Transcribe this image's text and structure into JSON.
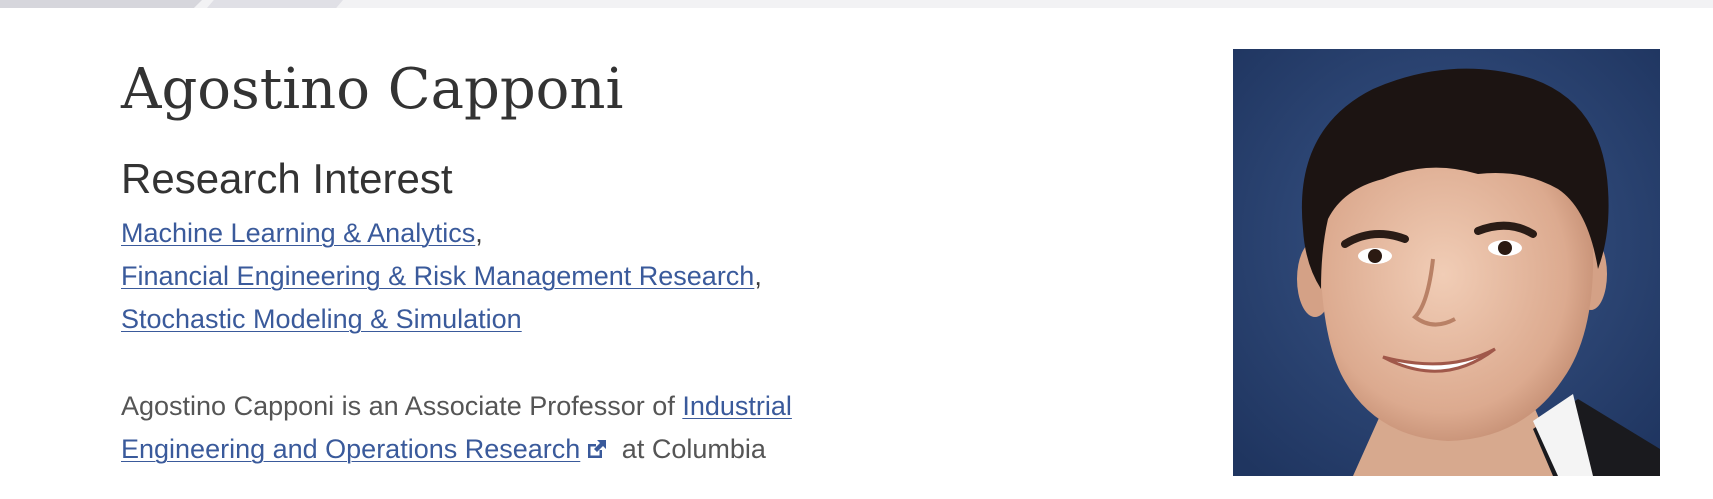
{
  "profile": {
    "name": "Agostino Capponi",
    "research_heading": "Research Interest",
    "interests": [
      {
        "label": "Machine Learning & Analytics",
        "sep": ","
      },
      {
        "label": "Financial Engineering & Risk Management Research",
        "sep": ","
      },
      {
        "label": "Stochastic Modeling & Simulation",
        "sep": ""
      }
    ],
    "bio": {
      "prefix": "Agostino Capponi is an Associate Professor of ",
      "link_text": "Industrial Engineering and Operations Research",
      "suffix": " at Columbia"
    },
    "photo_alt": "Portrait of Agostino Capponi"
  },
  "icons": {
    "external_link": "external-link-icon"
  },
  "colors": {
    "link": "#3a5a9b",
    "text": "#333333",
    "photo_background": "#2c4676"
  }
}
